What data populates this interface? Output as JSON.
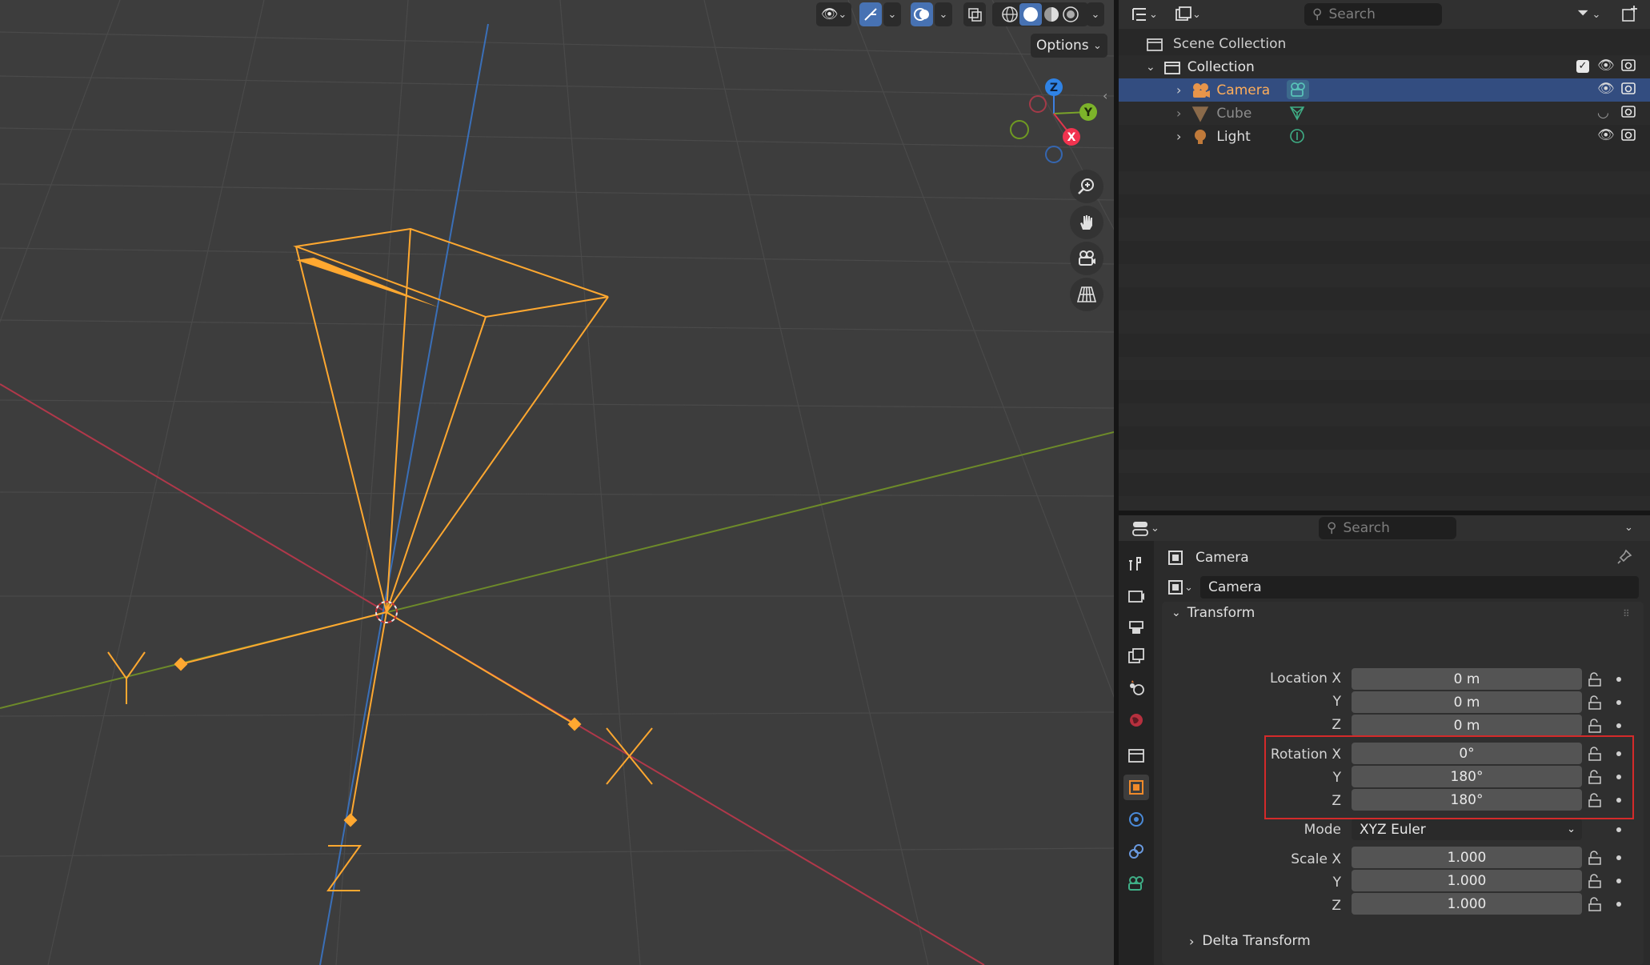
{
  "viewport": {
    "options_label": "Options",
    "gizmo": {
      "z": "Z",
      "y": "Y",
      "x": "X"
    },
    "axis_letters": {
      "y": "Y",
      "x": "X",
      "z": "Z"
    }
  },
  "outliner": {
    "search_placeholder": "Search",
    "scene_collection": "Scene Collection",
    "collection": "Collection",
    "items": [
      {
        "label": "Camera",
        "selected": true
      },
      {
        "label": "Cube",
        "selected": false
      },
      {
        "label": "Light",
        "selected": false
      }
    ]
  },
  "properties": {
    "search_placeholder": "Search",
    "breadcrumb": "Camera",
    "object_name": "Camera",
    "panel_title": "Transform",
    "location_label": "Location X",
    "location": [
      "0 m",
      "0 m",
      "0 m"
    ],
    "rotation_label": "Rotation X",
    "rotation": [
      "0°",
      "180°",
      "180°"
    ],
    "axis_y": "Y",
    "axis_z": "Z",
    "mode_label": "Mode",
    "mode_value": "XYZ Euler",
    "scale_label": "Scale X",
    "scale": [
      "1.000",
      "1.000",
      "1.000"
    ],
    "delta_label": "Delta Transform"
  },
  "colors": {
    "selection_accent": "#ff9a1f",
    "highlight_box": "#d42a2a",
    "selected_row": "#334d80",
    "active_button": "#4772b3"
  }
}
